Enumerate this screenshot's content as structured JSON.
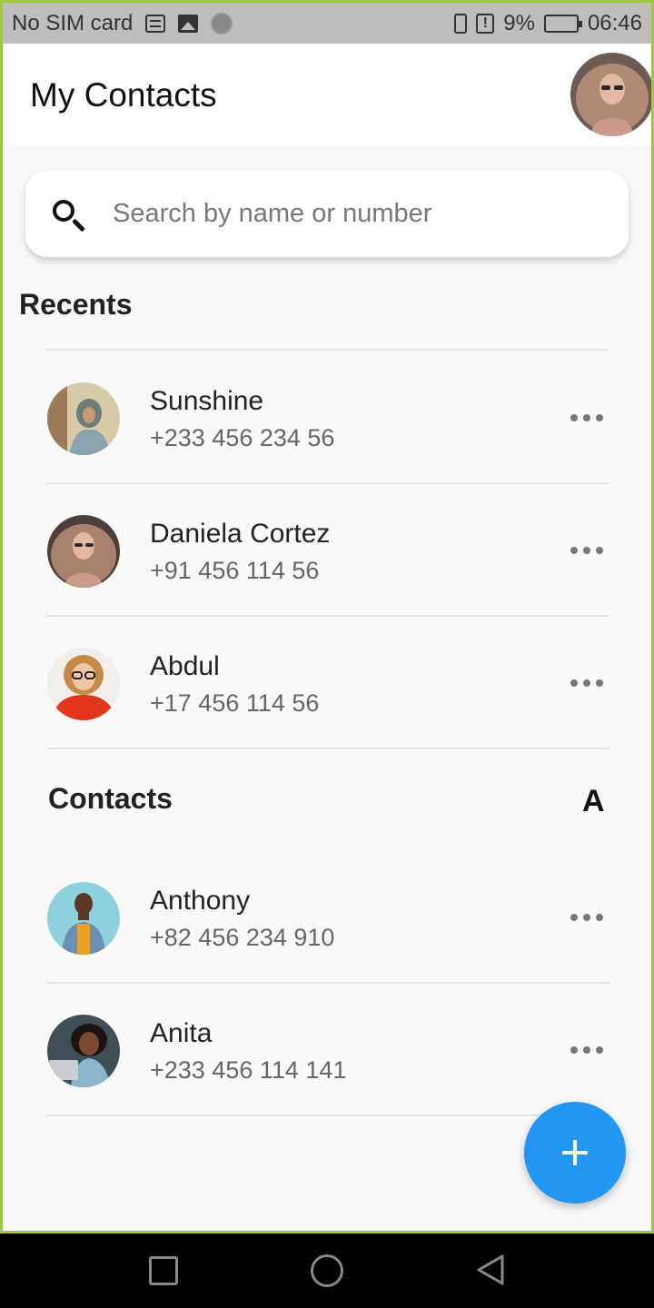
{
  "status_bar": {
    "carrier": "No SIM card",
    "battery": "9%",
    "time": "06:46"
  },
  "app_bar": {
    "title": "My Contacts"
  },
  "search": {
    "placeholder": "Search by name or number"
  },
  "recents": {
    "title": "Recents",
    "items": [
      {
        "name": "Sunshine",
        "phone": "+233 456 234 56"
      },
      {
        "name": "Daniela Cortez",
        "phone": "+91 456 114 56"
      },
      {
        "name": "Abdul",
        "phone": "+17 456 114 56"
      }
    ]
  },
  "contacts": {
    "title": "Contacts",
    "letter": "A",
    "items": [
      {
        "name": "Anthony",
        "phone": "+82 456 234 910"
      },
      {
        "name": "Anita",
        "phone": "+233 456 114 141"
      }
    ]
  },
  "colors": {
    "accent": "#2196f3",
    "frame": "#9fc93a"
  }
}
